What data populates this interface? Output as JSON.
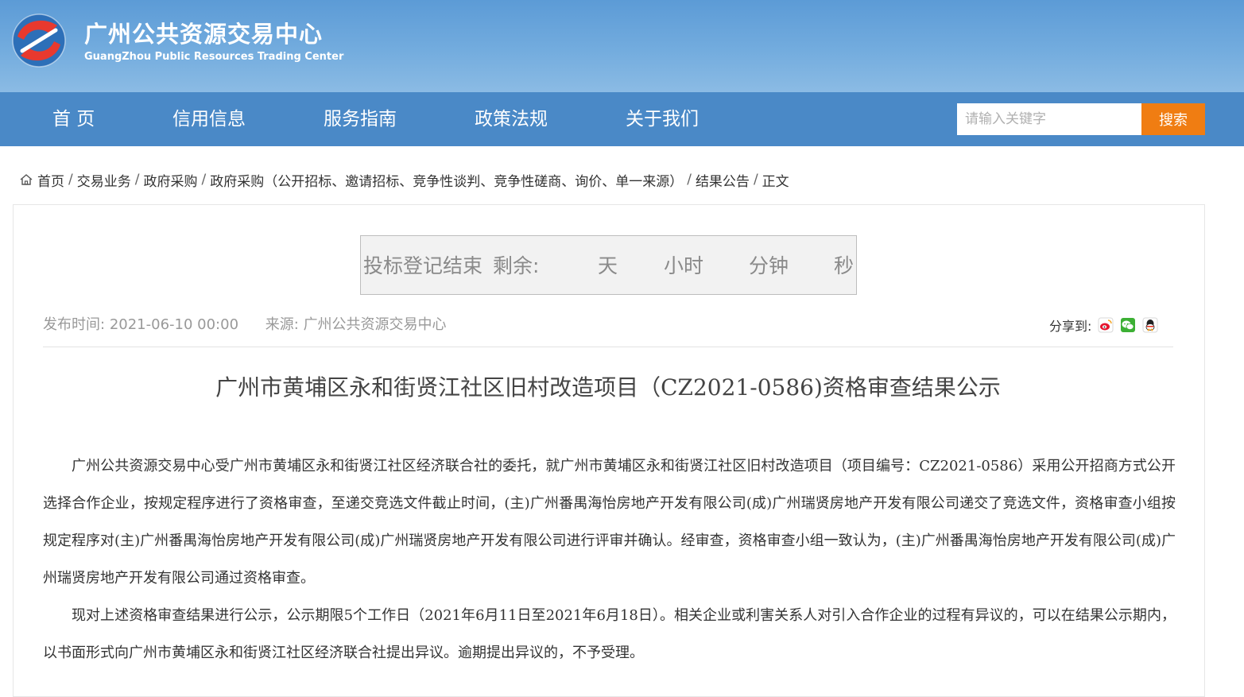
{
  "site": {
    "title": "广州公共资源交易中心",
    "subtitle": "GuangZhou Public Resources Trading Center",
    "logo_icon": "gzggzy-logo-icon"
  },
  "nav": {
    "items": [
      "首 页",
      "信用信息",
      "服务指南",
      "政策法规",
      "关于我们"
    ],
    "search_placeholder": "请输入关键字",
    "search_button": "搜索",
    "accent_color": "#f07d12",
    "nav_color": "#4a89c7"
  },
  "breadcrumb": {
    "items": [
      "首页",
      "交易业务",
      "政府采购",
      "政府采购（公开招标、邀请招标、竞争性谈判、竞争性磋商、询价、单一来源）",
      "结果公告",
      "正文"
    ],
    "separator": "/"
  },
  "countdown": {
    "label": "投标登记结束",
    "remaining": "剩余:",
    "day": "天",
    "hour": "小时",
    "minute": "分钟",
    "second": "秒"
  },
  "meta": {
    "publish_label": "发布时间:",
    "publish_time": "2021-06-10 00:00",
    "source_label": "来源:",
    "source": "广州公共资源交易中心",
    "share_label": "分享到:",
    "share_icons": [
      "weibo-icon",
      "wechat-icon",
      "qq-icon"
    ]
  },
  "article": {
    "title": "广州市黄埔区永和街贤江社区旧村改造项目（CZ2021-0586)资格审查结果公示",
    "paragraphs": [
      "广州公共资源交易中心受广州市黄埔区永和街贤江社区经济联合社的委托，就广州市黄埔区永和街贤江社区旧村改造项目（项目编号：CZ2021-0586）采用公开招商方式公开选择合作企业，按规定程序进行了资格审查，至递交竞选文件截止时间，(主)广州番禺海怡房地产开发有限公司(成)广州瑞贤房地产开发有限公司递交了竞选文件，资格审查小组按规定程序对(主)广州番禺海怡房地产开发有限公司(成)广州瑞贤房地产开发有限公司进行评审并确认。经审查，资格审查小组一致认为，(主)广州番禺海怡房地产开发有限公司(成)广州瑞贤房地产开发有限公司通过资格审查。",
      "现对上述资格审查结果进行公示，公示期限5个工作日（2021年6月11日至2021年6月18日）。相关企业或利害关系人对引入合作企业的过程有异议的，可以在结果公示期内，以书面形式向广州市黄埔区永和街贤江社区经济联合社提出异议。逾期提出异议的，不予受理。"
    ]
  }
}
